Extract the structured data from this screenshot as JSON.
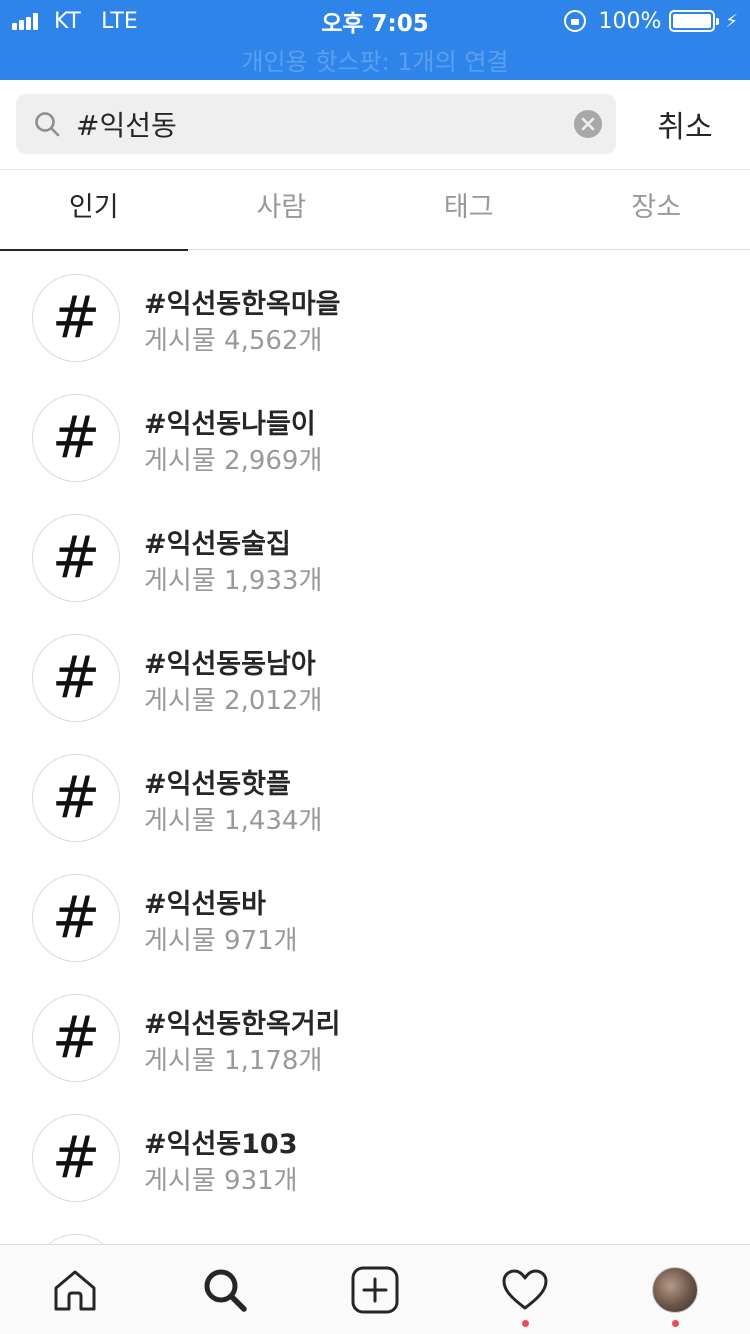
{
  "status_bar": {
    "carrier": "KT",
    "network": "LTE",
    "time": "오후 7:05",
    "battery_percent": "100%",
    "hotspot_text": "개인용 핫스팟: 1개의 연결",
    "background_color": "#2f84ea"
  },
  "search": {
    "query": "#익선동",
    "cancel_label": "취소"
  },
  "tabs": [
    {
      "label": "인기",
      "active": true
    },
    {
      "label": "사람",
      "active": false
    },
    {
      "label": "태그",
      "active": false
    },
    {
      "label": "장소",
      "active": false
    }
  ],
  "results": [
    {
      "icon": "#",
      "name": "#익선동한옥마을",
      "count": "게시물 4,562개"
    },
    {
      "icon": "#",
      "name": "#익선동나들이",
      "count": "게시물 2,969개"
    },
    {
      "icon": "#",
      "name": "#익선동술집",
      "count": "게시물 1,933개"
    },
    {
      "icon": "#",
      "name": "#익선동동남아",
      "count": "게시물 2,012개"
    },
    {
      "icon": "#",
      "name": "#익선동핫플",
      "count": "게시물 1,434개"
    },
    {
      "icon": "#",
      "name": "#익선동바",
      "count": "게시물 971개"
    },
    {
      "icon": "#",
      "name": "#익선동한옥거리",
      "count": "게시물 1,178개"
    },
    {
      "icon": "#",
      "name": "#익선동103",
      "count": "게시물 931개"
    }
  ],
  "bottom_nav": {
    "items": [
      "home-icon",
      "search-icon",
      "add-post-icon",
      "activity-heart-icon",
      "profile-avatar"
    ],
    "notification_color": "#ed4956"
  }
}
